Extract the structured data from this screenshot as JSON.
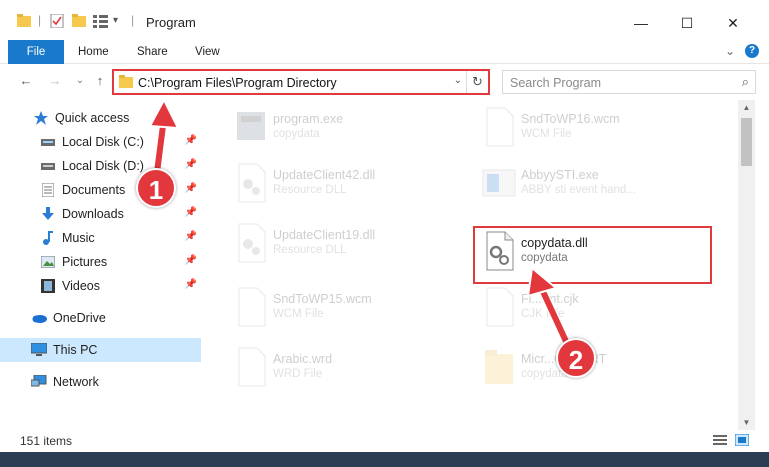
{
  "window": {
    "title": "Program",
    "minimize": "—",
    "maximize": "☐",
    "close": "✕"
  },
  "ribbon": {
    "tabs": [
      "File",
      "Home",
      "Share",
      "View"
    ],
    "expand": "⌄",
    "help": "?"
  },
  "nav": {
    "back": "←",
    "forward": "→",
    "dropdown": "⌄",
    "up": "↑"
  },
  "address": {
    "path": "C:\\Program Files\\Program Directory",
    "dropdown": "⌄",
    "refresh": "↻"
  },
  "search": {
    "placeholder": "Search Program",
    "icon": "⌕"
  },
  "sidebar": {
    "items": [
      {
        "label": "Quick access",
        "icon": "star-icon",
        "pinned": false
      },
      {
        "label": "Local Disk (C:)",
        "icon": "drive-icon",
        "pinned": true
      },
      {
        "label": "Local Disk (D:)",
        "icon": "drive-icon",
        "pinned": true
      },
      {
        "label": "Documents",
        "icon": "documents-icon",
        "pinned": true
      },
      {
        "label": "Downloads",
        "icon": "downloads-icon",
        "pinned": true
      },
      {
        "label": "Music",
        "icon": "music-icon",
        "pinned": true
      },
      {
        "label": "Pictures",
        "icon": "pictures-icon",
        "pinned": true
      },
      {
        "label": "Videos",
        "icon": "videos-icon",
        "pinned": true
      },
      {
        "label": "OneDrive",
        "icon": "cloud-icon",
        "pinned": false
      },
      {
        "label": "This PC",
        "icon": "computer-icon",
        "pinned": false,
        "selected": true
      },
      {
        "label": "Network",
        "icon": "network-icon",
        "pinned": false
      }
    ]
  },
  "files": [
    {
      "name": "program.exe",
      "type": "copydata",
      "faded": true
    },
    {
      "name": "SndToWP16.wcm",
      "type": "WCM File",
      "faded": true
    },
    {
      "name": "UpdateClient42.dll",
      "type": "Resource DLL",
      "faded": true
    },
    {
      "name": "AbbyySTI.exe",
      "type": "ABBY sti event hand...",
      "faded": true
    },
    {
      "name": "UpdateClient19.dll",
      "type": "Resource DLL",
      "faded": true
    },
    {
      "name": "copydata.dll",
      "type": "copydata",
      "faded": false
    },
    {
      "name": "SndToWP15.wcm",
      "type": "WCM File",
      "faded": true
    },
    {
      "name": "Fi...rmt.cjk",
      "type": "CJK File",
      "faded": true
    },
    {
      "name": "Arabic.wrd",
      "type": "WRD File",
      "faded": true
    },
    {
      "name": "Micr...C90.CRT",
      "type": "copydata",
      "faded": true
    }
  ],
  "status": {
    "count": "151 items"
  },
  "annotations": {
    "step1": "1",
    "step2": "2"
  },
  "colors": {
    "accent": "#1979ca",
    "highlight": "#e0393e",
    "selected_bg": "#cce8ff"
  }
}
